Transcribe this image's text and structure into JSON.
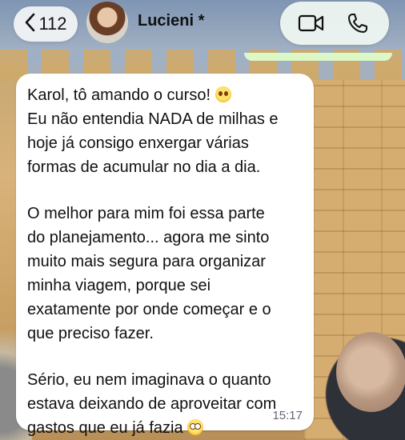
{
  "header": {
    "back_count": "112",
    "contact_name": "Lucieni *"
  },
  "message": {
    "lines": [
      "Karol, tô amando o curso!",
      "Eu não entendia NADA de milhas e",
      "hoje já consigo enxergar várias",
      "formas de acumular no dia a dia.",
      "",
      "O melhor para mim foi essa parte",
      "do planejamento... agora me sinto",
      "muito mais segura para organizar",
      "minha viagem, porque sei",
      "exatamente por onde começar e o",
      "que preciso fazer.",
      "",
      "Sério, eu nem imaginava o quanto",
      "estava deixando de aproveitar com",
      "gastos que eu já fazia"
    ],
    "time": "15:17",
    "emojis": [
      "pleading-face-emoji",
      "flushed-face-emoji"
    ]
  },
  "colors": {
    "bubble_bg": "#ffffff",
    "sent_bubble_bg": "#dcf8c6",
    "icon_color": "#111111"
  },
  "icons": [
    "chevron-left-icon",
    "video-call-icon",
    "phone-icon"
  ]
}
